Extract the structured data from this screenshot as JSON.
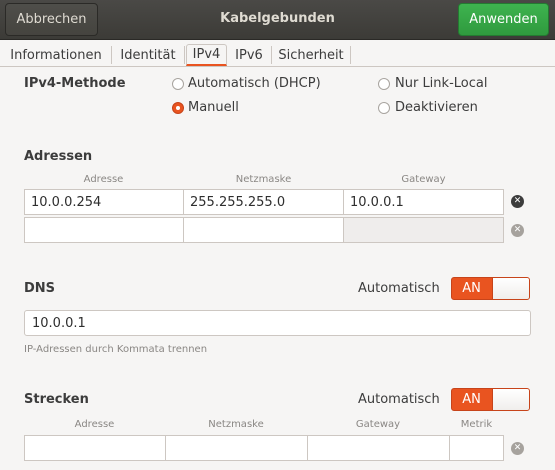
{
  "header": {
    "cancel_label": "Abbrechen",
    "title": "Kabelgebunden",
    "apply_label": "Anwenden"
  },
  "tabs": [
    {
      "label": "Informationen"
    },
    {
      "label": "Identität"
    },
    {
      "label": "IPv4"
    },
    {
      "label": "IPv6"
    },
    {
      "label": "Sicherheit"
    }
  ],
  "active_tab": "IPv4",
  "ipv4_method": {
    "label": "IPv4-Methode",
    "options": [
      "Automatisch (DHCP)",
      "Nur Link-Local",
      "Manuell",
      "Deaktivieren"
    ],
    "selected": "Manuell"
  },
  "addresses": {
    "heading": "Adressen",
    "columns": [
      "Adresse",
      "Netzmaske",
      "Gateway"
    ],
    "rows": [
      [
        "10.0.0.254",
        "255.255.255.0",
        "10.0.0.1"
      ],
      [
        "",
        "",
        ""
      ]
    ]
  },
  "dns": {
    "heading": "DNS",
    "auto_label": "Automatisch",
    "switch_label": "AN",
    "switch_on": true,
    "value": "10.0.0.1",
    "hint": "IP-Adressen durch Kommata trennen"
  },
  "routes": {
    "heading": "Strecken",
    "auto_label": "Automatisch",
    "switch_label": "AN",
    "switch_on": true,
    "columns": [
      "Adresse",
      "Netzmaske",
      "Gateway",
      "Metrik"
    ],
    "rows": [
      [
        "",
        "",
        "",
        ""
      ]
    ]
  },
  "icons": {
    "delete": "x-circle-icon"
  },
  "colors": {
    "accent": "#e95420",
    "apply_green": "#3eb34f",
    "header_bg": "#3c3b37"
  }
}
